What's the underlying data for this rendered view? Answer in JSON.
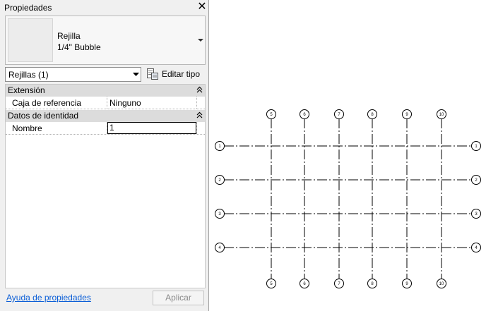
{
  "palette": {
    "title": "Propiedades",
    "close_glyph": "✕",
    "type_selector": {
      "family": "Rejilla",
      "type": "1/4\" Bubble"
    },
    "filter": {
      "value": "Rejillas (1)"
    },
    "edit_type_label": "Editar tipo",
    "groups": {
      "extension": {
        "title": "Extensión",
        "row": {
          "name": "Caja de referencia",
          "value": "Ninguno"
        }
      },
      "identity": {
        "title": "Datos de identidad",
        "row": {
          "name": "Nombre",
          "value": "1"
        }
      }
    },
    "help_link": "Ayuda de propiedades",
    "apply_label": "Aplicar"
  },
  "grid": {
    "horizontal_labels": [
      "1",
      "2",
      "3",
      "4"
    ],
    "vertical_labels": [
      "5",
      "6",
      "7",
      "8",
      "9",
      "10"
    ]
  }
}
